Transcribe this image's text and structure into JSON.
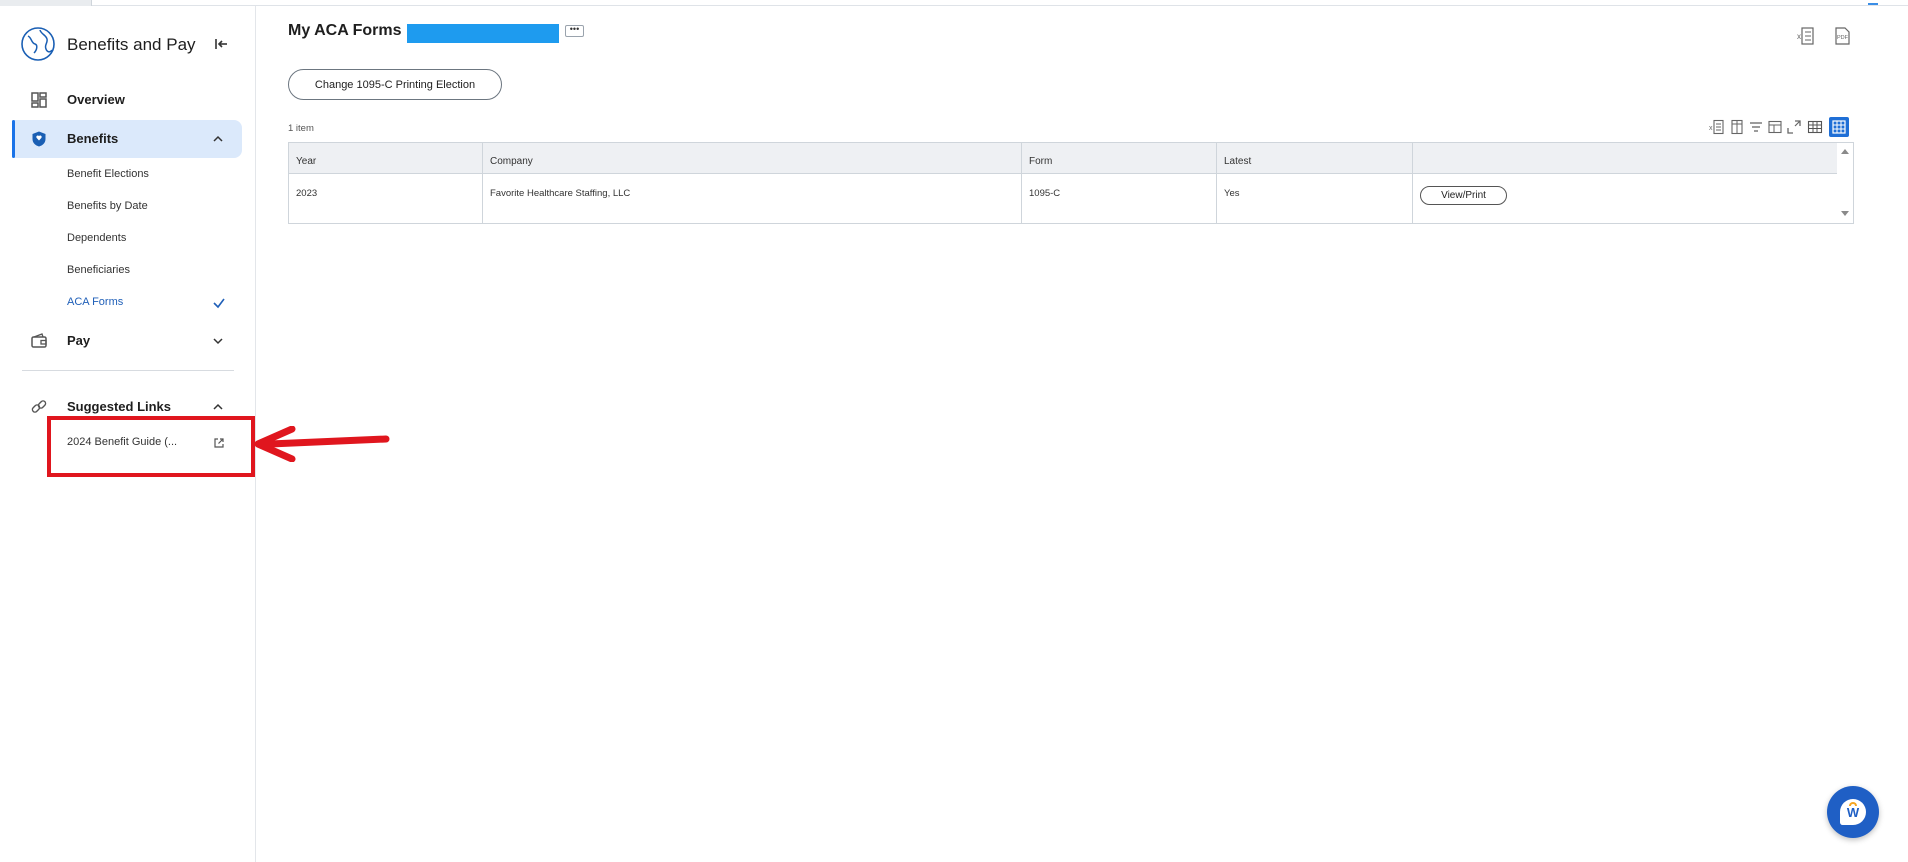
{
  "app": {
    "title": "Benefits and Pay"
  },
  "sidebar": {
    "overview_label": "Overview",
    "benefits": {
      "label": "Benefits",
      "items": [
        {
          "label": "Benefit Elections"
        },
        {
          "label": "Benefits by Date"
        },
        {
          "label": "Dependents"
        },
        {
          "label": "Beneficiaries"
        },
        {
          "label": "ACA Forms"
        }
      ],
      "current_item": "ACA Forms"
    },
    "pay_label": "Pay",
    "suggested": {
      "label": "Suggested Links",
      "links": [
        {
          "label": "2024 Benefit Guide (..."
        }
      ]
    }
  },
  "header": {
    "title": "My ACA Forms"
  },
  "actions": {
    "change_election_label": "Change 1095-C Printing Election"
  },
  "table": {
    "count_label": "1 item",
    "columns": [
      "Year",
      "Company",
      "Form",
      "Latest",
      ""
    ],
    "rows": [
      {
        "year": "2023",
        "company": "Favorite Healthcare Staffing, LLC",
        "form": "1095-C",
        "latest": "Yes",
        "action_label": "View/Print"
      }
    ]
  },
  "assistant": {
    "glyph": "W"
  },
  "colors": {
    "accent": "#1a73e8",
    "active_bg": "#dbe9fb",
    "redaction": "#1e9bef",
    "annotation_red": "#e0161e",
    "assistant_bg": "#1f5fc5"
  },
  "icons": [
    "globe-icon",
    "collapse-sidebar-icon",
    "dashboard-icon",
    "shield-icon",
    "chevron-up-icon",
    "chevron-down-icon",
    "checkmark-icon",
    "wallet-icon",
    "link-icon",
    "external-link-icon",
    "more-icon",
    "export-excel-icon",
    "export-pdf-icon",
    "filter-icon",
    "fullscreen-icon",
    "grid-view-icon",
    "table-view-icon"
  ]
}
